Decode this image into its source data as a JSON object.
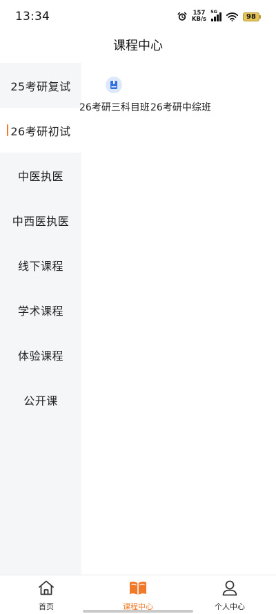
{
  "status_bar": {
    "time": "13:34",
    "net_speed_value": "157",
    "net_speed_unit": "KB/s",
    "signal_generation": "5G",
    "battery": "98",
    "icons": [
      "alarm-icon",
      "wifi-icon",
      "signal-icon",
      "battery-icon"
    ]
  },
  "header": {
    "title": "课程中心"
  },
  "sidebar": {
    "active_index": 1,
    "items": [
      {
        "label": "25考研复试"
      },
      {
        "label": "26考研初试"
      },
      {
        "label": "中医执医"
      },
      {
        "label": "中西医执医"
      },
      {
        "label": "线下课程"
      },
      {
        "label": "学术课程"
      },
      {
        "label": "体验课程"
      },
      {
        "label": "公开课"
      }
    ]
  },
  "content": {
    "course_icon": "book-icon",
    "courses": [
      {
        "label": "26考研三科目班"
      },
      {
        "label": "26考研中综班"
      }
    ]
  },
  "tabbar": {
    "active_index": 1,
    "accent_color": "#f07a2a",
    "tabs": [
      {
        "label": "首页",
        "icon": "home-icon"
      },
      {
        "label": "课程中心",
        "icon": "open-book-icon"
      },
      {
        "label": "个人中心",
        "icon": "person-icon"
      }
    ]
  }
}
